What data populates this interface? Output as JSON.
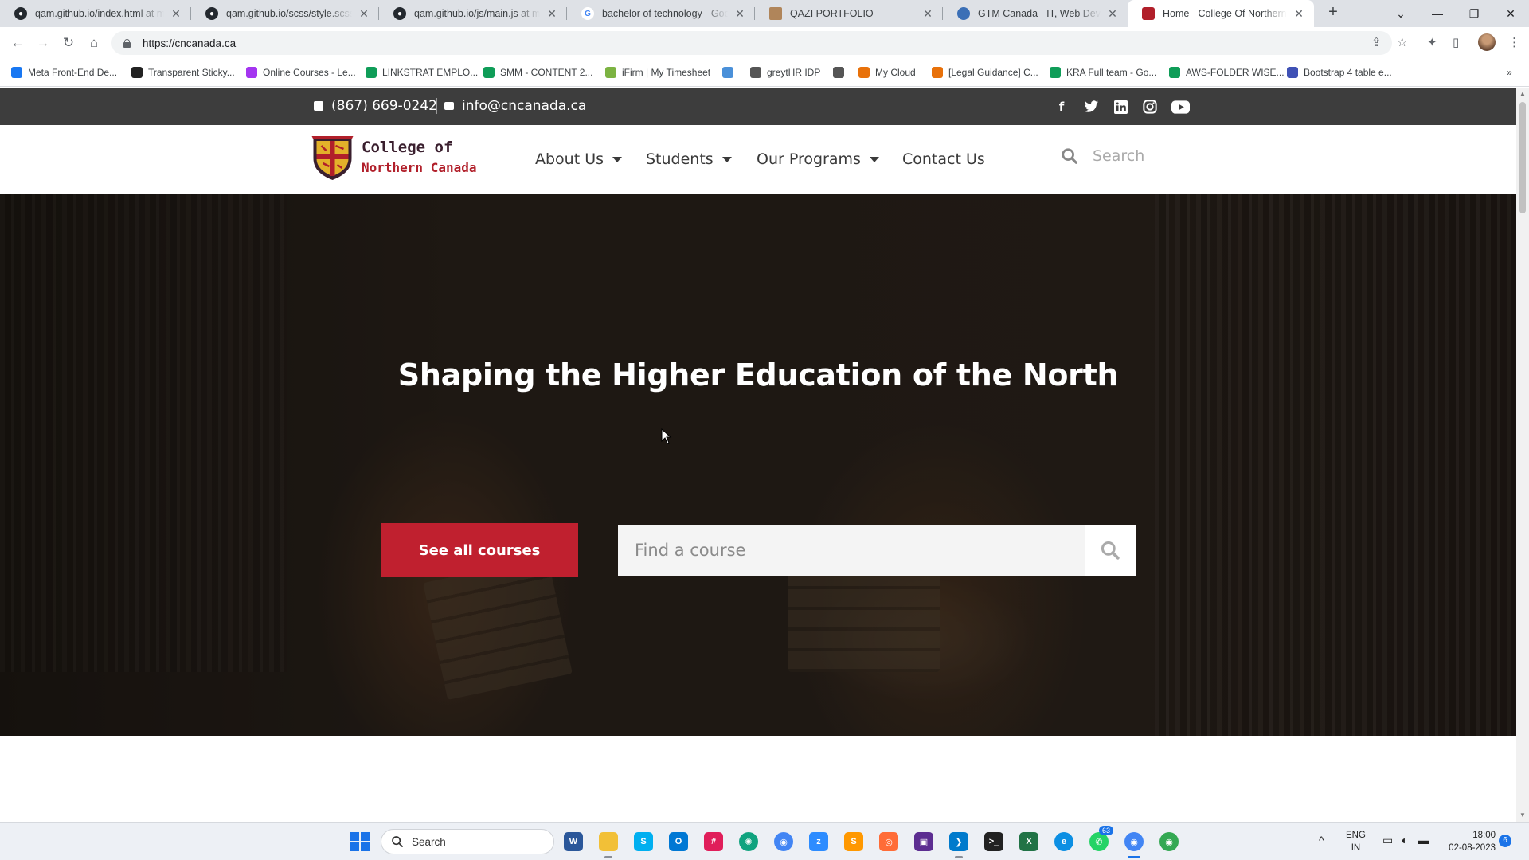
{
  "browser": {
    "tabs": [
      {
        "title": "qam.github.io/index.html at main",
        "favicon": "github-icon",
        "active": false
      },
      {
        "title": "qam.github.io/scss/style.scss at main",
        "favicon": "github-icon",
        "active": false
      },
      {
        "title": "qam.github.io/js/main.js at main",
        "favicon": "github-icon",
        "active": false
      },
      {
        "title": "bachelor of technology - Google Search",
        "favicon": "google-icon",
        "active": false
      },
      {
        "title": "QAZI PORTFOLIO",
        "favicon": "portfolio-icon",
        "active": false
      },
      {
        "title": "GTM Canada - IT, Web Development",
        "favicon": "gtm-icon",
        "active": false
      },
      {
        "title": "Home - College Of Northern Canada",
        "favicon": "college-icon",
        "active": true
      }
    ],
    "url": "https://cncanada.ca",
    "bookmarks": [
      {
        "label": "Meta Front-End De...",
        "icon": "meta-icon",
        "color": "#1877f2"
      },
      {
        "label": "Transparent Sticky...",
        "icon": "pen-icon",
        "color": "#222222"
      },
      {
        "label": "Online Courses - Le...",
        "icon": "udemy-icon",
        "color": "#a435f0"
      },
      {
        "label": "LINKSTRAT EMPLO...",
        "icon": "sheets-icon",
        "color": "#0f9d58"
      },
      {
        "label": "SMM - CONTENT 2...",
        "icon": "sheets-icon",
        "color": "#0f9d58"
      },
      {
        "label": "iFirm | My Timesheet",
        "icon": "ifirm-icon",
        "color": "#7cb342"
      },
      {
        "label": "",
        "icon": "globe-icon",
        "color": "#4a90d9"
      },
      {
        "label": "greytHR IDP",
        "icon": "greythr-icon",
        "color": "#555555"
      },
      {
        "label": "",
        "icon": "globe-icon",
        "color": "#555555"
      },
      {
        "label": "My Cloud",
        "icon": "cloud-icon",
        "color": "#e8710a"
      },
      {
        "label": "[Legal Guidance] C...",
        "icon": "legal-icon",
        "color": "#e8710a"
      },
      {
        "label": "KRA Full team - Go...",
        "icon": "sheets-icon",
        "color": "#0f9d58"
      },
      {
        "label": "AWS-FOLDER WISE...",
        "icon": "sheets-icon",
        "color": "#0f9d58"
      },
      {
        "label": "Bootstrap 4 table e...",
        "icon": "mdb-icon",
        "color": "#3f51b5"
      }
    ]
  },
  "site": {
    "topbar": {
      "phone": "(867) 669-0242",
      "email": "info@cncanada.ca",
      "social": [
        "facebook-icon",
        "twitter-icon",
        "linkedin-icon",
        "instagram-icon",
        "youtube-icon"
      ]
    },
    "logo": {
      "line1": "College of",
      "line2": "Northern Canada"
    },
    "nav": [
      {
        "label": "About Us",
        "dropdown": true
      },
      {
        "label": "Students",
        "dropdown": true
      },
      {
        "label": "Our Programs",
        "dropdown": true
      },
      {
        "label": "Contact Us",
        "dropdown": false
      }
    ],
    "header_search_placeholder": "Search",
    "hero": {
      "heading": "Shaping the Higher Education of the North",
      "cta_label": "See all courses",
      "search_placeholder": "Find a course"
    },
    "colors": {
      "brand_red": "#c0202f",
      "topbar": "#3d3d3d",
      "logo_dark": "#3a1f2e"
    }
  },
  "taskbar": {
    "search_label": "Search",
    "apps": [
      "word-icon",
      "file-explorer-icon",
      "skype-icon",
      "outlook-icon",
      "slack-icon",
      "chatgpt-icon",
      "chrome-icon",
      "zoom-icon",
      "sublime-icon",
      "postman-icon",
      "visual-studio-icon",
      "vscode-icon",
      "terminal-icon",
      "excel-icon",
      "edge-icon",
      "whatsapp-icon",
      "chrome-profile-icon",
      "chrome-alt-icon"
    ],
    "whatsapp_badge": "63",
    "lang_line1": "ENG",
    "lang_line2": "IN",
    "time": "18:00",
    "date": "02-08-2023",
    "notification_count": "6"
  }
}
